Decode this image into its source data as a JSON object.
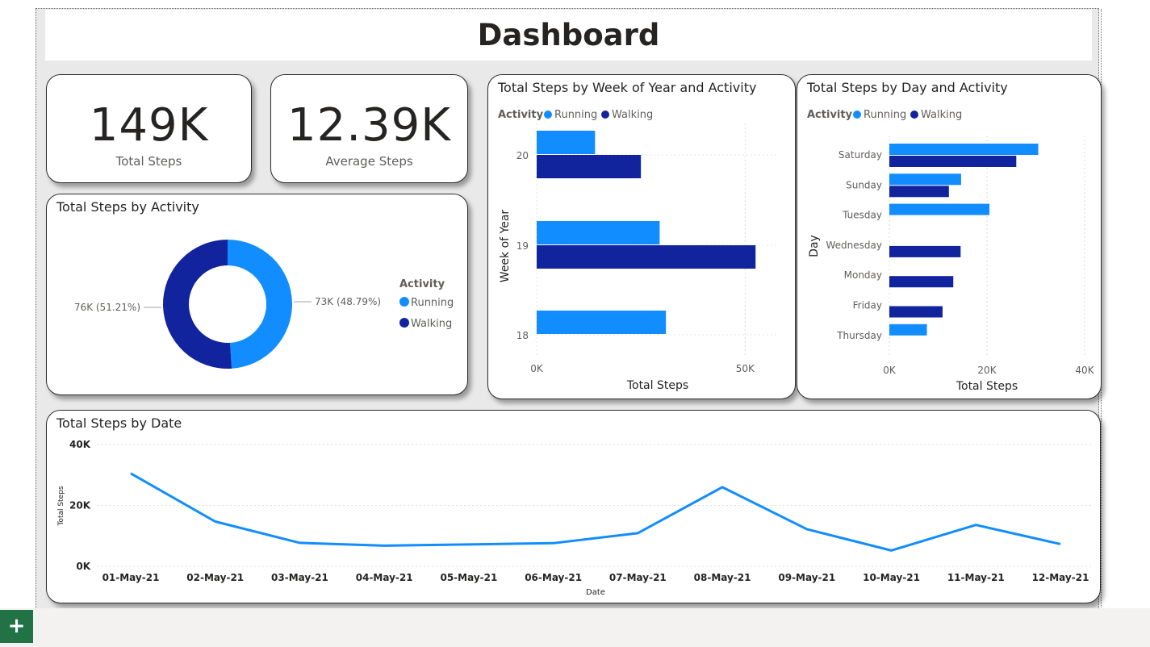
{
  "title": "Dashboard",
  "kpis": [
    {
      "value": "149K",
      "label": "Total Steps"
    },
    {
      "value": "12.39K",
      "label": "Average Steps"
    }
  ],
  "colors": {
    "running": "#118dff",
    "walking": "#12239e"
  },
  "donut": {
    "title": "Total Steps by Activity",
    "legend_title": "Activity",
    "running_label": "73K (48.79%)",
    "walking_label": "76K (51.21%)"
  },
  "week_chart": {
    "title": "Total Steps by Week of Year and Activity",
    "legend_title": "Activity"
  },
  "day_chart": {
    "title": "Total Steps by Day and Activity",
    "legend_title": "Activity"
  },
  "date_chart": {
    "title": "Total Steps by Date"
  },
  "add_page_icon": "plus-icon",
  "chart_data": [
    {
      "type": "pie",
      "title": "Total Steps by Activity",
      "legend_title": "Activity",
      "categories": [
        "Running",
        "Walking"
      ],
      "values": [
        73,
        76
      ],
      "unit": "K",
      "labels": [
        "73K (48.79%)",
        "76K (51.21%)"
      ],
      "percentages": [
        48.79,
        51.21
      ],
      "legend_position": "right"
    },
    {
      "type": "bar",
      "orientation": "horizontal",
      "title": "Total Steps by Week of Year and Activity",
      "xlabel": "Total Steps",
      "ylabel": "Week of Year",
      "categories": [
        "20",
        "19",
        "18"
      ],
      "series": [
        {
          "name": "Running",
          "values": [
            14000,
            29500,
            31000
          ]
        },
        {
          "name": "Walking",
          "values": [
            25000,
            52500,
            0
          ]
        }
      ],
      "xlim": [
        0,
        60000
      ],
      "xticks": [
        "0K",
        "50K"
      ],
      "legend_title": "Activity",
      "legend_position": "top-left",
      "grid": true
    },
    {
      "type": "bar",
      "orientation": "horizontal",
      "title": "Total Steps by Day and Activity",
      "xlabel": "Total Steps",
      "ylabel": "Day",
      "categories": [
        "Saturday",
        "Sunday",
        "Tuesday",
        "Wednesday",
        "Monday",
        "Friday",
        "Thursday"
      ],
      "series": [
        {
          "name": "Running",
          "values": [
            30500,
            14700,
            20500,
            0,
            0,
            0,
            7700
          ]
        },
        {
          "name": "Walking",
          "values": [
            26000,
            12200,
            0,
            14600,
            13100,
            10900,
            0
          ]
        }
      ],
      "xlim": [
        0,
        40000
      ],
      "xticks": [
        "0K",
        "20K",
        "40K"
      ],
      "legend_title": "Activity",
      "legend_position": "top-left",
      "grid": true
    },
    {
      "type": "line",
      "title": "Total Steps by Date",
      "xlabel": "Date",
      "ylabel": "Total Steps",
      "x": [
        "01-May-21",
        "02-May-21",
        "03-May-21",
        "04-May-21",
        "05-May-21",
        "06-May-21",
        "07-May-21",
        "08-May-21",
        "09-May-21",
        "10-May-21",
        "11-May-21",
        "12-May-21"
      ],
      "series": [
        {
          "values": [
            30500,
            14700,
            7700,
            6800,
            7200,
            7600,
            10900,
            26000,
            12200,
            5200,
            13600,
            7300
          ]
        }
      ],
      "ylim": [
        0,
        40000
      ],
      "yticks": [
        "0K",
        "20K",
        "40K"
      ],
      "grid": true
    }
  ]
}
